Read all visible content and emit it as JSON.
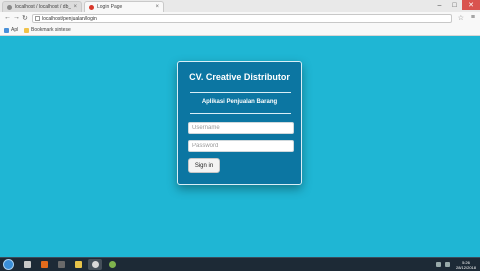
{
  "browser": {
    "tabs": [
      {
        "label": "localhost / localhost / db_pe..."
      },
      {
        "label": "Login Page"
      }
    ],
    "window_controls": {
      "minimize": "–",
      "maximize": "□",
      "close": "✕"
    },
    "nav": {
      "back": "←",
      "forward": "→",
      "reload": "↻"
    },
    "url": "localhost/penjualan/login",
    "bookmarks": [
      {
        "label": "Apl"
      },
      {
        "label": "Bookmark sintese"
      }
    ]
  },
  "login": {
    "title": "CV. Creative Distributor",
    "subtitle": "Aplikasi Penjualan Barang",
    "username_placeholder": "Username",
    "password_placeholder": "Password",
    "submit_label": "Sign in"
  },
  "taskbar": {
    "time": "5:26",
    "date": "28/12/2018"
  },
  "colors": {
    "page_background": "#1fb6d4",
    "card_background": "#0c76a2",
    "taskbar": "#1d2a36"
  }
}
